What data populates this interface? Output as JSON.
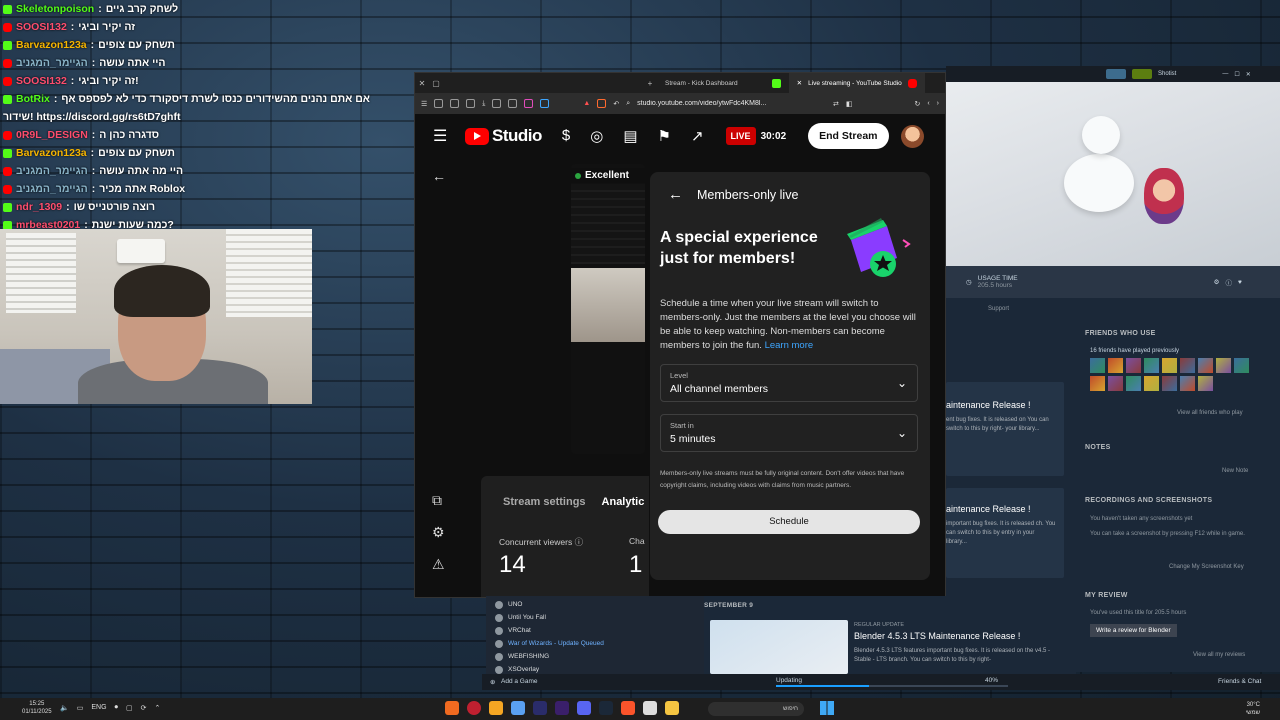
{
  "chat": [
    {
      "user": "Skeletonpoison",
      "user_color": "#53fc18",
      "badge": "kick",
      "message": "לשחק קרב גיים"
    },
    {
      "user": "SOOSI132",
      "user_color": "#ff4d6d",
      "badge": "yt",
      "message": "זה יקיר וביגי"
    },
    {
      "user": "Barvazon123a",
      "user_color": "#f5b400",
      "badge": "kick",
      "message": "תשחק עם צופים"
    },
    {
      "user": "הגיימר_המגניב",
      "user_color": "#8ab4c8",
      "badge": "yt",
      "message": "היי אתה עושה"
    },
    {
      "user": "SOOSI132",
      "user_color": "#ff4d6d",
      "badge": "yt",
      "message": "זה יקיר וביגי!"
    },
    {
      "user": "BotRix",
      "user_color": "#53fc18",
      "badge": "kick",
      "message": "אם אתם נהנים מהשידורים כנסו לשרת דיסקורד כדי לא לפספס אף"
    },
    {
      "user": "",
      "user_color": "#ffffff",
      "badge": "",
      "message": "שידור! https://discord.gg/rs6tD7ghft"
    },
    {
      "user": "0R9L_DESIGN",
      "user_color": "#ff4d6d",
      "badge": "yt",
      "message": "סדגרה כהן ה"
    },
    {
      "user": "Barvazon123a",
      "user_color": "#f5b400",
      "badge": "kick",
      "message": "תשחק עם צופים"
    },
    {
      "user": "הגיימר_המגניב",
      "user_color": "#8ab4c8",
      "badge": "yt",
      "message": "היי מה אתה עושה"
    },
    {
      "user": "הגיימר_המגניב",
      "user_color": "#8ab4c8",
      "badge": "yt",
      "message": "אתה מכיר Roblox"
    },
    {
      "user": "ndr_1309",
      "user_color": "#ff4d6d",
      "badge": "kick",
      "message": "רוצה פורטנייס שו"
    },
    {
      "user": "mrbeast0201",
      "user_color": "#ff4d6d",
      "badge": "kick",
      "message": "כמה שעות ישנת?"
    }
  ],
  "browser": {
    "tabs": [
      "Stream - Kick Dashboard",
      "Live streaming - YouTube Studio"
    ],
    "url": "studio.youtube.com/video/ytwFdc4KM8l..."
  },
  "studio": {
    "logo_text": "Studio",
    "live_label": "LIVE",
    "live_time": "30:02",
    "end_stream": "End Stream",
    "signal": "Excellent",
    "tab_stream_settings": "Stream settings",
    "tab_analytics": "Analytic",
    "concurrent_label": "Concurrent viewers",
    "concurrent_value": "14",
    "cha_label": "Cha",
    "cha_value": "1"
  },
  "dialog": {
    "title": "Members-only live",
    "hero": "A special experience just for members!",
    "desc": "Schedule a time when your live stream will switch to members-only. Just the members at the level you choose will be able to keep watching. Non-members can become members to join the fun.",
    "learn_more": "Learn more",
    "level_label": "Level",
    "level_value": "All channel members",
    "start_label": "Start in",
    "start_value": "5 minutes",
    "note": "Members-only live streams must be fully original content. Don't offer videos that have copyright claims, including videos with claims from music partners.",
    "schedule": "Schedule"
  },
  "steam": {
    "user": "Shotist",
    "usage_label": "USAGE TIME",
    "usage_value": "205.5 hours",
    "support": "Support",
    "library": [
      "UNO",
      "Until You Fall",
      "VRChat",
      "War of Wizards - Update Queued",
      "WEBFISHING",
      "XSOverlay"
    ],
    "news": [
      {
        "title": "aintenance Release !",
        "body": "ent bug fixes. It is released on You can switch to this by right- your library..."
      },
      {
        "title": "aintenance Release !",
        "body": "important bug fixes. It is released ch. You can switch to this by entry in your library..."
      },
      {
        "date": "SEPTEMBER 9",
        "tag": "REGULAR UPDATE",
        "title": "Blender 4.5.3 LTS Maintenance Release !",
        "body": "Blender 4.5.3 LTS features important bug fixes. It is released on the v4.5 - Stable - LTS branch. You can switch to this by right-"
      }
    ],
    "friends_head": "FRIENDS WHO USE",
    "friends_played": "16 friends have played previously",
    "view_friends": "View all friends who play",
    "notes_head": "NOTES",
    "new_note": "New Note",
    "recordings_head": "RECORDINGS AND SCREENSHOTS",
    "rec_line1": "You haven't taken any screenshots yet",
    "rec_line2": "You can take a screenshot by pressing F12 while in game.",
    "change_key": "Change My Screenshot Key",
    "review_head": "MY REVIEW",
    "review_line": "You've used this title for 205.5 hours",
    "write_review": "Write a review for Blender",
    "view_reviews": "View all my reviews",
    "add_game": "Add a Game",
    "updating": "Updating",
    "progress_pct": "40%",
    "progress_value": 0.4,
    "friends_chat": "Friends & Chat"
  },
  "taskbar": {
    "time": "15:25",
    "date": "01/11/2025",
    "lang": "ENG",
    "search": "חיפוש",
    "temp": "30°C",
    "weather": "שמשי"
  }
}
